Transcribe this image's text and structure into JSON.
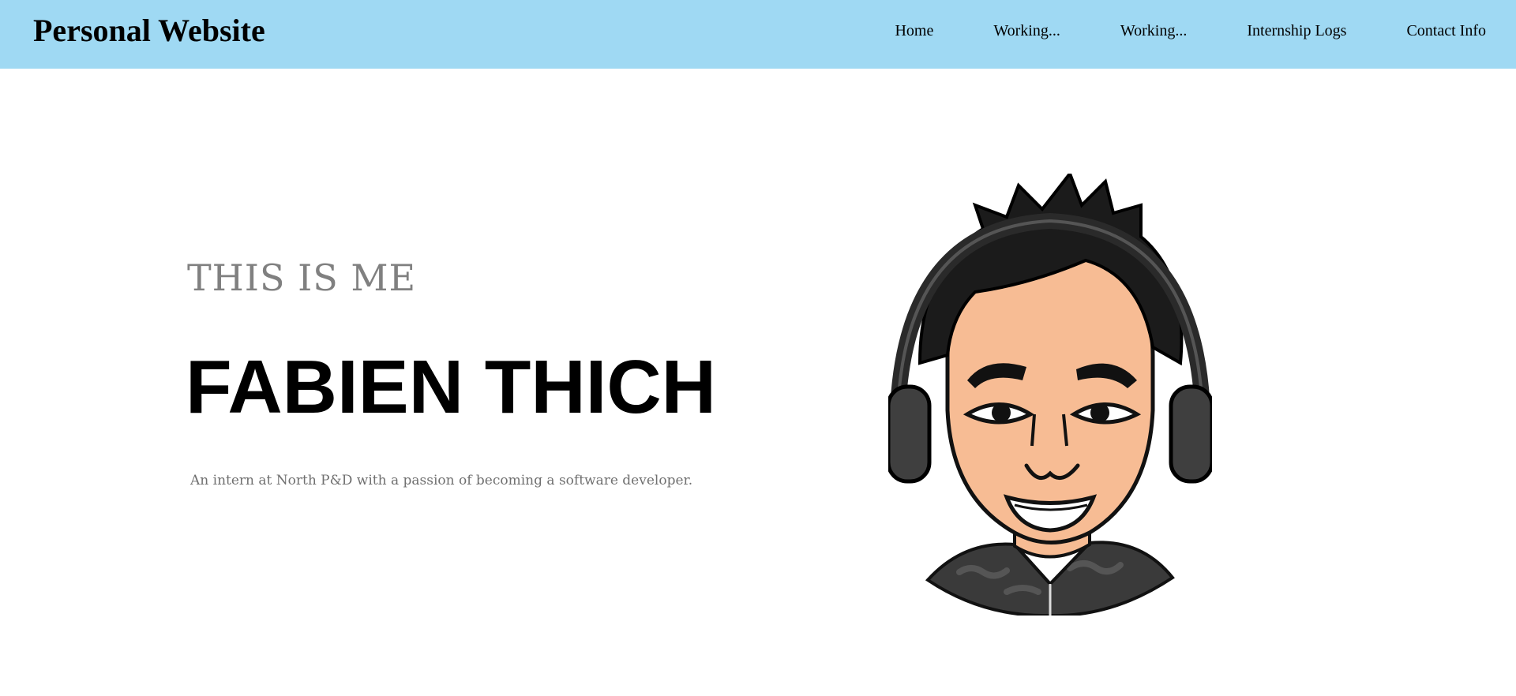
{
  "header": {
    "brand": "Personal Website",
    "nav": [
      "Home",
      "Working...",
      "Working...",
      "Internship Logs",
      "Contact Info"
    ],
    "background": "#9fd9f3"
  },
  "hero": {
    "kicker": "THIS IS ME",
    "name": "FABIEN THICH",
    "tagline": "An intern at North P&D with a passion of becoming a software developer.",
    "avatar_icon": "bitmoji-avatar-with-headphones"
  }
}
